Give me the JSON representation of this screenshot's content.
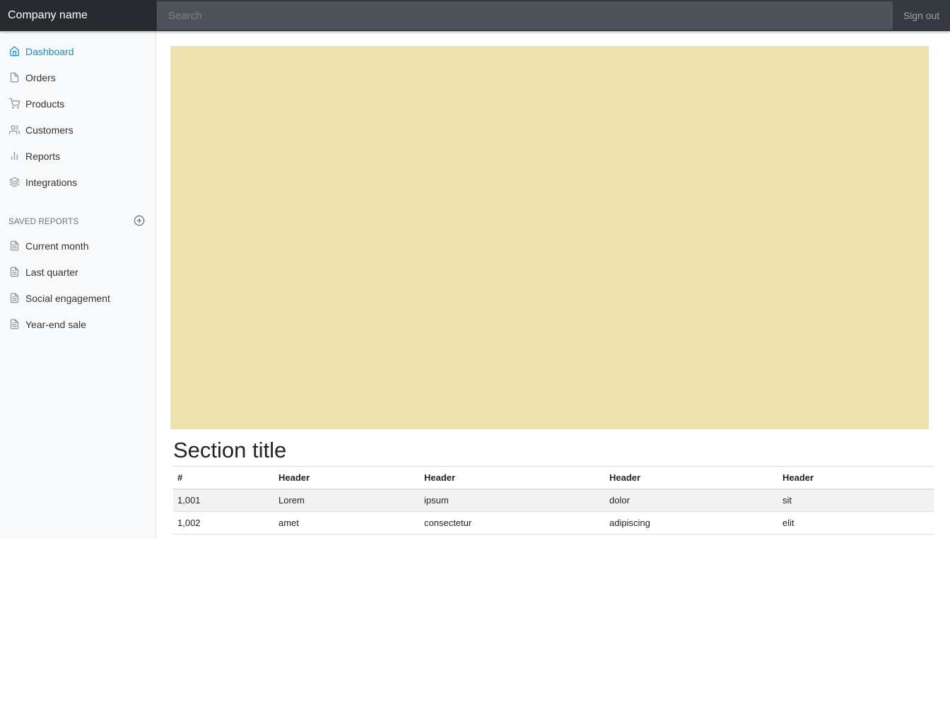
{
  "topbar": {
    "brand": "Company name",
    "search_placeholder": "Search",
    "signout_label": "Sign out"
  },
  "sidebar": {
    "items": [
      {
        "label": "Dashboard",
        "icon": "home-icon",
        "active": true
      },
      {
        "label": "Orders",
        "icon": "file-icon"
      },
      {
        "label": "Products",
        "icon": "shopping-cart-icon"
      },
      {
        "label": "Customers",
        "icon": "users-icon"
      },
      {
        "label": "Reports",
        "icon": "bar-chart-icon"
      },
      {
        "label": "Integrations",
        "icon": "layers-icon"
      }
    ],
    "saved_reports_title": "SAVED REPORTS",
    "saved_reports": [
      {
        "label": "Current month",
        "icon": "file-text-icon"
      },
      {
        "label": "Last quarter",
        "icon": "file-text-icon"
      },
      {
        "label": "Social engagement",
        "icon": "file-text-icon"
      },
      {
        "label": "Year-end sale",
        "icon": "file-text-icon"
      }
    ]
  },
  "main": {
    "chart_placeholder_color": "#ede2b0",
    "section_title": "Section title",
    "table": {
      "headers": [
        "#",
        "Header",
        "Header",
        "Header",
        "Header"
      ],
      "rows": [
        [
          "1,001",
          "Lorem",
          "ipsum",
          "dolor",
          "sit"
        ],
        [
          "1,002",
          "amet",
          "consectetur",
          "adipiscing",
          "elit"
        ]
      ]
    }
  },
  "colors": {
    "topbar_bg": "#343a40",
    "brand_bg": "#272b30",
    "active_link": "#1f8ab6",
    "sidebar_bg": "#f8f9fa"
  }
}
